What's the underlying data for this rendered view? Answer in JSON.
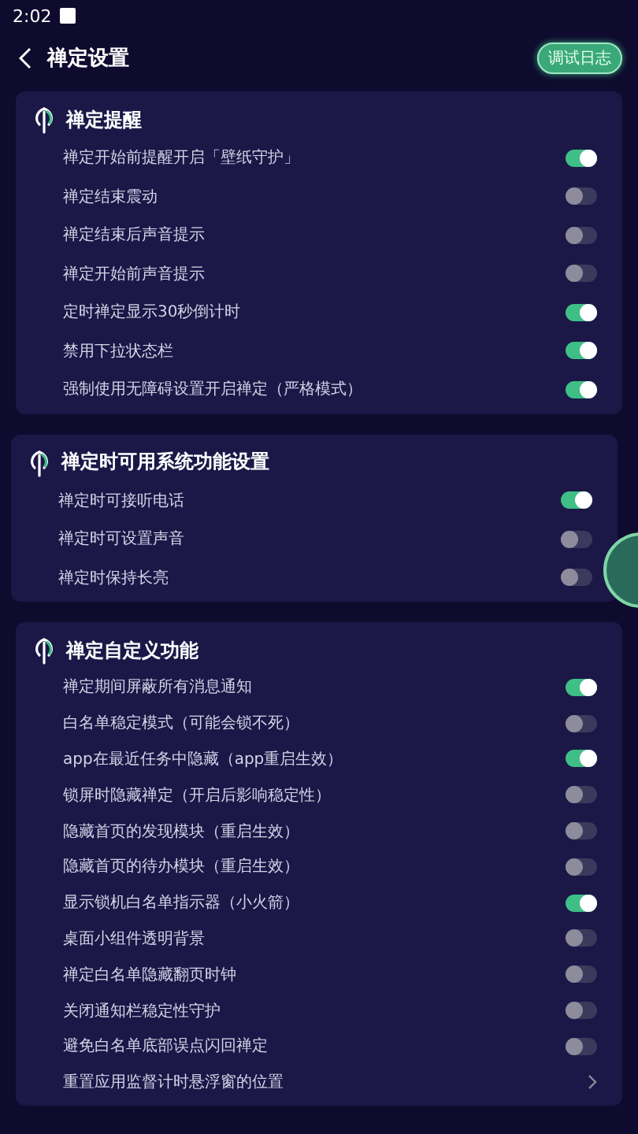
{
  "status_bar": {
    "time": "2:02"
  },
  "header": {
    "title": "禅定设置",
    "action": "调试日志"
  },
  "sections": [
    {
      "title": "禅定提醒",
      "rows": [
        {
          "kind": "toggle",
          "label": "禅定开始前提醒开启「壁纸守护」",
          "on": true
        },
        {
          "kind": "toggle",
          "label": "禅定结束震动",
          "on": false
        },
        {
          "kind": "toggle",
          "label": "禅定结束后声音提示",
          "on": false
        },
        {
          "kind": "toggle",
          "label": "禅定开始前声音提示",
          "on": false
        },
        {
          "kind": "toggle",
          "label": "定时禅定显示30秒倒计时",
          "on": true
        },
        {
          "kind": "toggle",
          "label": "禁用下拉状态栏",
          "on": true
        },
        {
          "kind": "toggle",
          "label": "强制使用无障碍设置开启禅定（严格模式）",
          "on": true
        }
      ]
    },
    {
      "title": "禅定时可用系统功能设置",
      "rows": [
        {
          "kind": "toggle",
          "label": "禅定时可接听电话",
          "on": true
        },
        {
          "kind": "toggle",
          "label": "禅定时可设置声音",
          "on": false
        },
        {
          "kind": "toggle",
          "label": "禅定时保持长亮",
          "on": false
        }
      ]
    },
    {
      "title": "禅定自定义功能",
      "rows": [
        {
          "kind": "toggle",
          "label": "禅定期间屏蔽所有消息通知",
          "on": true
        },
        {
          "kind": "toggle",
          "label": "白名单稳定模式（可能会锁不死）",
          "on": false
        },
        {
          "kind": "toggle",
          "label": "app在最近任务中隐藏（app重启生效）",
          "on": true
        },
        {
          "kind": "toggle",
          "label": "锁屏时隐藏禅定（开启后影响稳定性）",
          "on": false
        },
        {
          "kind": "toggle",
          "label": "隐藏首页的发现模块（重启生效）",
          "on": false
        },
        {
          "kind": "toggle",
          "label": "隐藏首页的待办模块（重启生效）",
          "on": false
        },
        {
          "kind": "toggle",
          "label": "显示锁机白名单指示器（小火箭）",
          "on": true
        },
        {
          "kind": "toggle",
          "label": "桌面小组件透明背景",
          "on": false
        },
        {
          "kind": "toggle",
          "label": "禅定白名单隐藏翻页时钟",
          "on": false
        },
        {
          "kind": "toggle",
          "label": "关闭通知栏稳定性守护",
          "on": false
        },
        {
          "kind": "toggle",
          "label": "避免白名单底部误点闪回禅定",
          "on": false
        },
        {
          "kind": "link",
          "label": "重置应用监督计时悬浮窗的位置"
        }
      ]
    }
  ]
}
